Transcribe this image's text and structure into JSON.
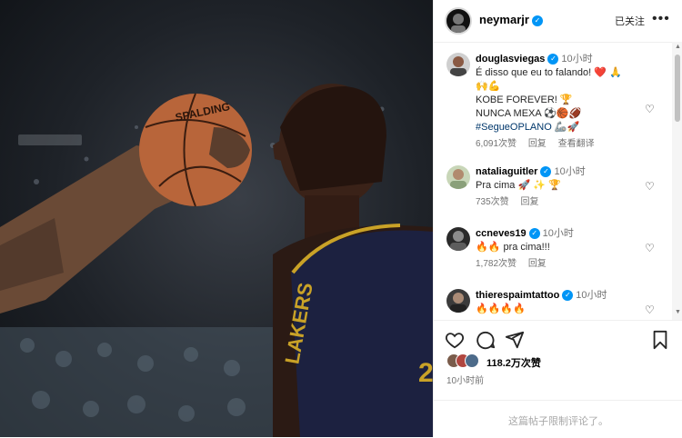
{
  "post": {
    "username": "neymarjr",
    "verified_mark": "✓",
    "follow_status": "已关注",
    "more_icon": "more-horizontal-icon"
  },
  "comments": [
    {
      "user": "douglasviegas",
      "time": "10小时",
      "lines": [
        "É disso que eu to falando! ❤️ 🙏",
        "🙌💪",
        "KOBE FOREVER! 🏆",
        "NUNCA MEXA ⚽🏀🏈"
      ],
      "tag": "#SegueOPLANO",
      "tag_emoji": "🦾🚀",
      "likes": "6,091次赞",
      "reply": "回复",
      "translate": "查看翻译"
    },
    {
      "user": "nataliaguitler",
      "time": "10小时",
      "lines": [
        "Pra cima 🚀 ✨ 🏆"
      ],
      "likes": "735次赞",
      "reply": "回复"
    },
    {
      "user": "ccneves19",
      "time": "10小时",
      "lines": [
        "🔥🔥 pra cima!!!"
      ],
      "likes": "1,782次赞",
      "reply": "回复"
    },
    {
      "user": "thierespaimtattoo",
      "time": "10小时",
      "lines": [
        "🔥🔥🔥🔥"
      ]
    }
  ],
  "likes_total": "118.2万次赞",
  "post_time": "10小时前",
  "comments_disabled": "这篇帖子限制评论了。",
  "colors": {
    "verified": "#0095f6",
    "heart_red": "#ed4956",
    "tag_blue": "#00376b"
  }
}
